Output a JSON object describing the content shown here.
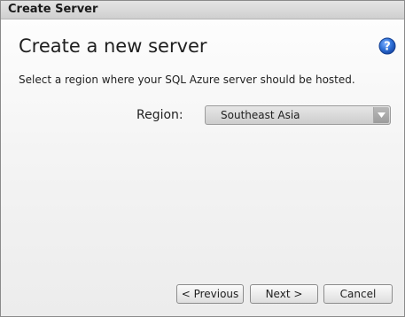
{
  "window": {
    "title": "Create Server"
  },
  "main": {
    "heading": "Create a new server",
    "instruction": "Select a region where your SQL Azure server should be hosted.",
    "help_icon": "help-question-icon"
  },
  "region": {
    "label": "Region:",
    "selected": "Southeast Asia"
  },
  "footer": {
    "previous_label": "< Previous",
    "next_label": "Next >",
    "cancel_label": "Cancel"
  }
}
